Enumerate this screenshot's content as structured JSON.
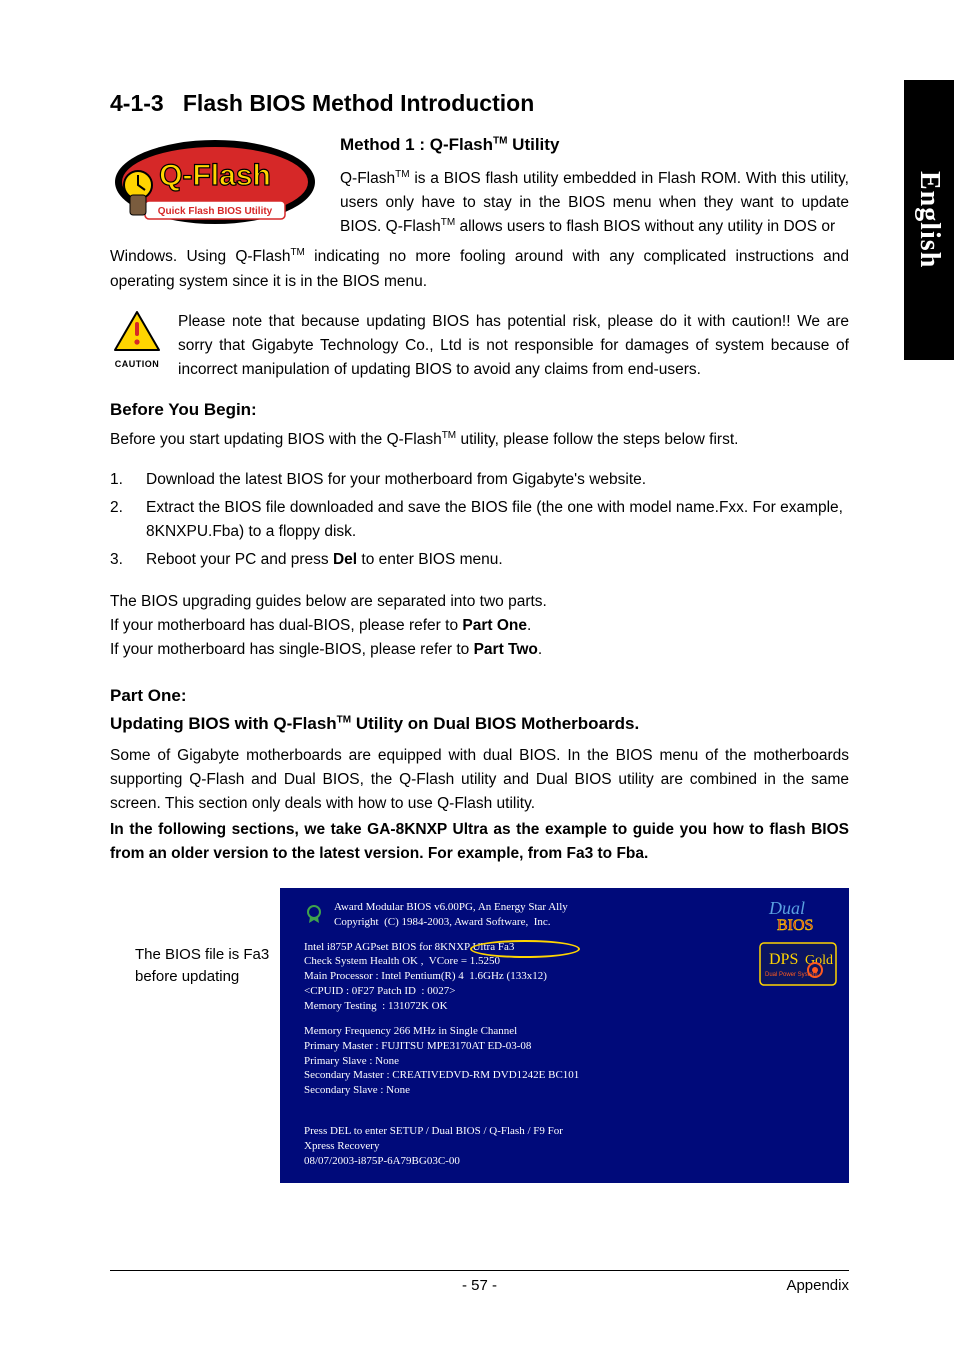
{
  "sideTab": "English",
  "sectionNumber": "4-1-3",
  "sectionTitle": "Flash BIOS Method Introduction",
  "method1Title": "Method 1 : Q-Flash",
  "method1TitleSuffix": " Utility",
  "tm": "TM",
  "introPart1": "Q-Flash",
  "introPart2": " is a BIOS flash utility embedded in Flash ROM. With this utility, users only have to stay in the BIOS menu when they want to update BIOS. Q-Flash",
  "introPart3": " allows users to flash BIOS without any utility in DOS or",
  "introCont": "Windows. Using Q-Flash",
  "introCont2": " indicating no more fooling around with any complicated instructions and operating system since it is in the BIOS menu.",
  "cautionLabel": "CAUTION",
  "cautionText": "Please note that because updating BIOS has potential risk, please do it with caution!! We are sorry that Gigabyte Technology Co., Ltd is not responsible for damages of system because of incorrect manipulation of updating BIOS to avoid any claims from end-users.",
  "beforeTitle": "Before You Begin:",
  "beforeText1": "Before you start updating BIOS with the Q-Flash",
  "beforeText2": " utility, please follow the steps below first.",
  "steps": [
    "Download the latest BIOS for your motherboard from Gigabyte's website.",
    "Extract the BIOS file downloaded and save the BIOS file (the one with model name.Fxx. For example, 8KNXPU.Fba) to a floppy disk.",
    "Reboot your PC and press "
  ],
  "step3Key": "Del",
  "step3Suffix": " to enter BIOS menu.",
  "guidesPara1": "The BIOS upgrading guides below are separated into two parts.",
  "guidesPara2a": "If your motherboard has dual-BIOS, please refer to ",
  "guidesPara2b": "Part One",
  "guidesPara3a": "If your motherboard has single-BIOS, please refer to ",
  "guidesPara3b": "Part Two",
  "partOneTitle": "Part One:",
  "partOneSub1": "Updating BIOS with Q-Flash",
  "partOneSub2": " Utility on Dual BIOS Motherboards.",
  "partOneBody": "Some of Gigabyte motherboards are equipped with dual BIOS. In the BIOS menu of the motherboards supporting Q-Flash and Dual BIOS, the Q-Flash utility and Dual BIOS utility are combined in the same screen. This section only deals with how to use Q-Flash utility.",
  "partOneBold": "In the following sections, we take GA-8KNXP Ultra as the example to guide you how to flash BIOS from an older version to the latest version. For example, from Fa3 to Fba.",
  "caption": "The BIOS file is Fa3 before updating",
  "bios": {
    "header1": "Award Modular BIOS v6.00PG, An Energy Star Ally",
    "header2": "Copyright  (C) 1984-2003, Award Software,  Inc.",
    "l1": "Intel i875P AGPset BIOS for 8KNXP Ultra Fa3",
    "l2": "Check System Health OK ,  VCore = 1.5250",
    "l3": "Main Processor : Intel Pentium(R) 4  1.6GHz (133x12)",
    "l4": "<CPUID : 0F27 Patch ID  : 0027>",
    "l5": "Memory Testing  : 131072K OK",
    "l6": "Memory Frequency 266 MHz in Single Channel",
    "l7": "Primary Master : FUJITSU MPE3170AT ED-03-08",
    "l8": "Primary Slave : None",
    "l9": "Secondary Master : CREATIVEDVD-RM DVD1242E BC101",
    "l10": "Secondary Slave : None",
    "l11": "Press DEL to enter SETUP / Dual BIOS / Q-Flash / F9 For",
    "l12": "Xpress Recovery",
    "l13": "08/07/2003-i875P-6A79BG03C-00"
  },
  "qflashLogo": {
    "main": "Q-Flash",
    "sub": "Quick Flash BIOS Utility"
  },
  "dualBiosText": "Dual",
  "dualBiosText2": "BIOS",
  "dpsText": "DPS",
  "dpsGold": "Gold",
  "dpsSub": "Dual Power System",
  "footerPage": "- 57 -",
  "footerRight": "Appendix"
}
